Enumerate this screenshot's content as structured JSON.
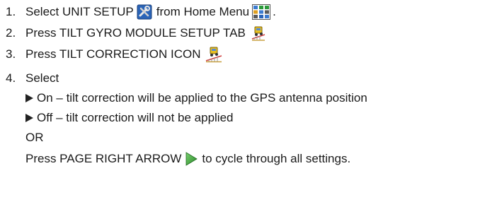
{
  "steps": [
    {
      "number": "1.",
      "text_before": "Select UNIT SETUP",
      "icon1": "unit-setup-icon",
      "text_middle": "from Home Menu",
      "icon2": "home-menu-icon",
      "text_after": "."
    },
    {
      "number": "2.",
      "text": "Press TILT GYRO MODULE SETUP TAB",
      "icon": "tilt-gyro-module-icon"
    },
    {
      "number": "3.",
      "text": "Press TILT CORRECTION ICON",
      "icon": "tilt-correction-icon"
    },
    {
      "number": "4.",
      "text": "Select",
      "options": [
        "On – tilt correction will be applied to the GPS antenna position",
        "Off – tilt correction will not be applied"
      ],
      "or_label": "OR",
      "page_right_before": "Press PAGE RIGHT ARROW",
      "page_right_icon": "page-right-arrow-icon",
      "page_right_after": "to cycle through all settings."
    }
  ]
}
